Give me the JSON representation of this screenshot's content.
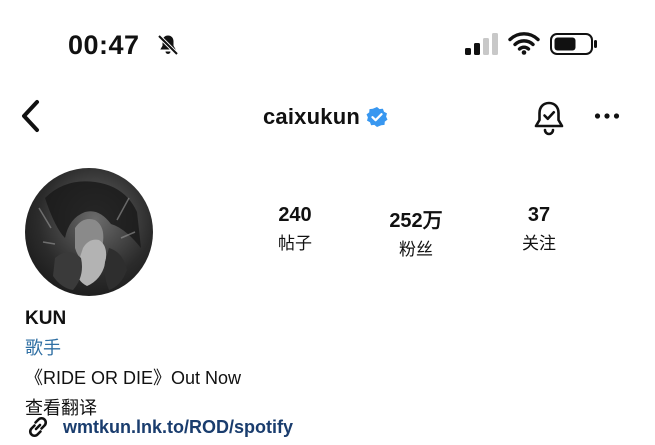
{
  "status_bar": {
    "time": "00:47",
    "icons": [
      "bell-off-icon",
      "signal-icon",
      "wifi-icon",
      "battery-icon"
    ]
  },
  "nav": {
    "username": "caixukun",
    "icons": [
      "back-icon",
      "verified-badge-icon",
      "notification-bell-icon",
      "more-icon"
    ],
    "verified_color": "#3897f0"
  },
  "stats": {
    "posts_value": "240",
    "posts_label": "帖子",
    "followers_value": "252万",
    "followers_label": "粉丝",
    "following_value": "37",
    "following_label": "关注"
  },
  "bio": {
    "name": "KUN",
    "category": "歌手",
    "text": "《RIDE OR DIE》Out Now",
    "translate": "查看翻译",
    "link": "wmtkun.lnk.to/ROD/spotify"
  }
}
